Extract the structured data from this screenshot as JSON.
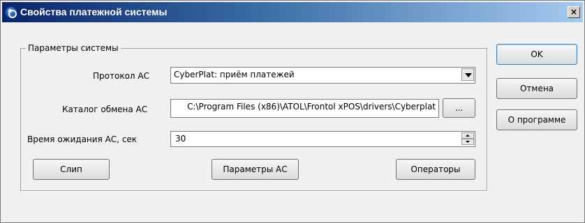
{
  "window": {
    "title": "Свойства платежной системы",
    "close_label": "×"
  },
  "group": {
    "legend": "Параметры системы"
  },
  "fields": {
    "protocol_label": "Протокол АС",
    "protocol_value": "CyberPlat: приём платежей",
    "catalog_label": "Каталог обмена АС",
    "catalog_value": "C:\\Program Files (x86)\\ATOL\\Frontol xPOS\\drivers\\Cyberplat",
    "browse_label": "...",
    "timeout_label": "Время ожидания АС, сек",
    "timeout_value": "30"
  },
  "group_buttons": {
    "slip": "Слип",
    "params": "Параметры АС",
    "operators": "Операторы"
  },
  "side_buttons": {
    "ok": "OK",
    "cancel": "Отмена",
    "about": "О программе"
  }
}
